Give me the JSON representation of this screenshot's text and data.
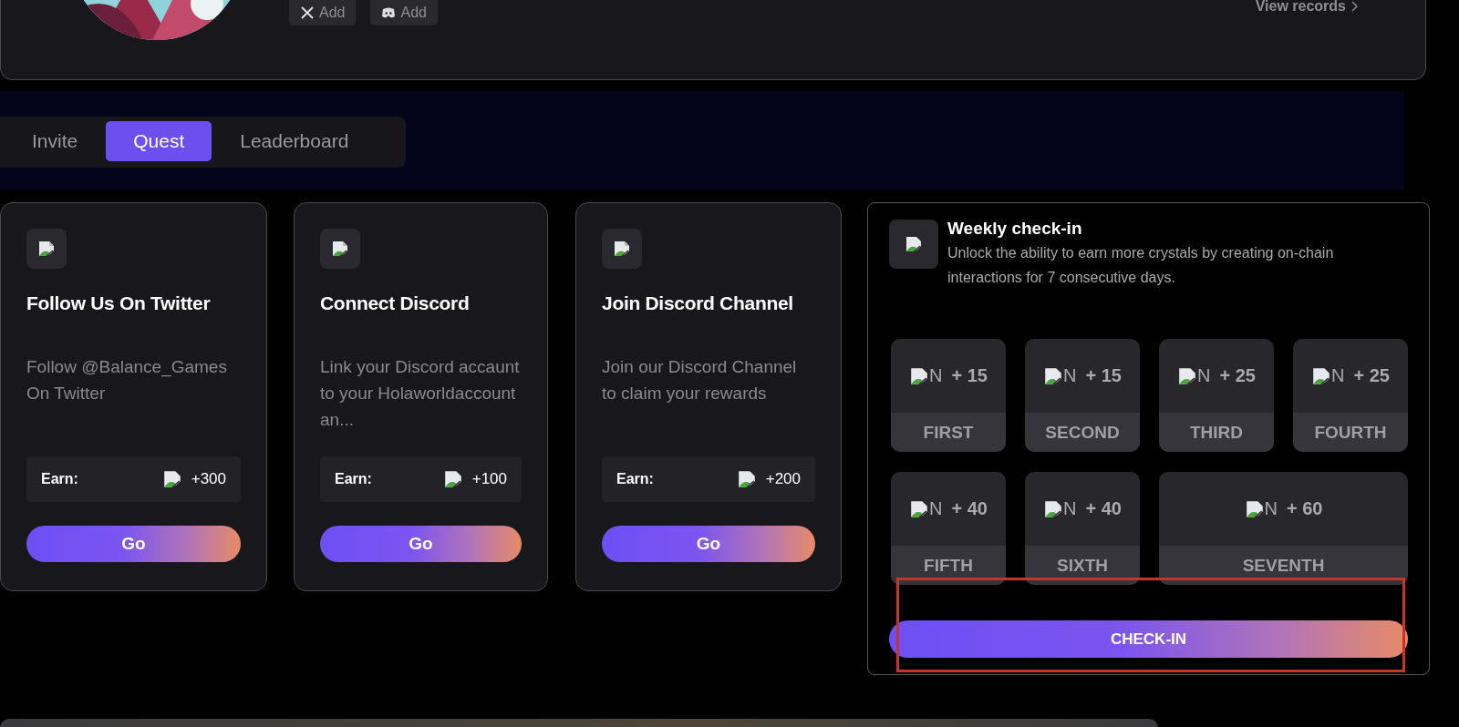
{
  "profile": {
    "social_buttons": [
      {
        "kind": "x",
        "label": "Add"
      },
      {
        "kind": "discord",
        "label": "Add"
      }
    ],
    "view_records": "View records"
  },
  "tabs": [
    {
      "label": "Invite",
      "selected": false
    },
    {
      "label": "Quest",
      "selected": true
    },
    {
      "label": "Leaderboard",
      "selected": false
    }
  ],
  "quests": [
    {
      "title": "Follow Us On Twitter",
      "description": "Follow @Balance_Games On Twitter",
      "earn_label": "Earn:",
      "reward": "+300",
      "button": "Go"
    },
    {
      "title": "Connect Discord",
      "description": "Link your Discord accaunt to your Holaworldaccount an...",
      "earn_label": "Earn:",
      "reward": "+100",
      "button": "Go"
    },
    {
      "title": "Join Discord Channel",
      "description": "Join our Discord Channel to claim your rewards",
      "earn_label": "Earn:",
      "reward": "+200",
      "button": "Go"
    }
  ],
  "weekly_checkin": {
    "title": "Weekly check-in",
    "description": "Unlock the ability to earn more crystals by creating on-chain interactions for 7 consecutive days.",
    "days": [
      {
        "alt": "N",
        "reward": "+ 15",
        "label": "FIRST"
      },
      {
        "alt": "N",
        "reward": "+ 15",
        "label": "SECOND"
      },
      {
        "alt": "N",
        "reward": "+ 25",
        "label": "THIRD"
      },
      {
        "alt": "N",
        "reward": "+ 25",
        "label": "FOURTH"
      },
      {
        "alt": "N",
        "reward": "+ 40",
        "label": "FIFTH"
      },
      {
        "alt": "N",
        "reward": "+ 40",
        "label": "SIXTH"
      },
      {
        "alt": "N",
        "reward": "+ 60",
        "label": "SEVENTH"
      }
    ],
    "button": "CHECK-IN"
  }
}
